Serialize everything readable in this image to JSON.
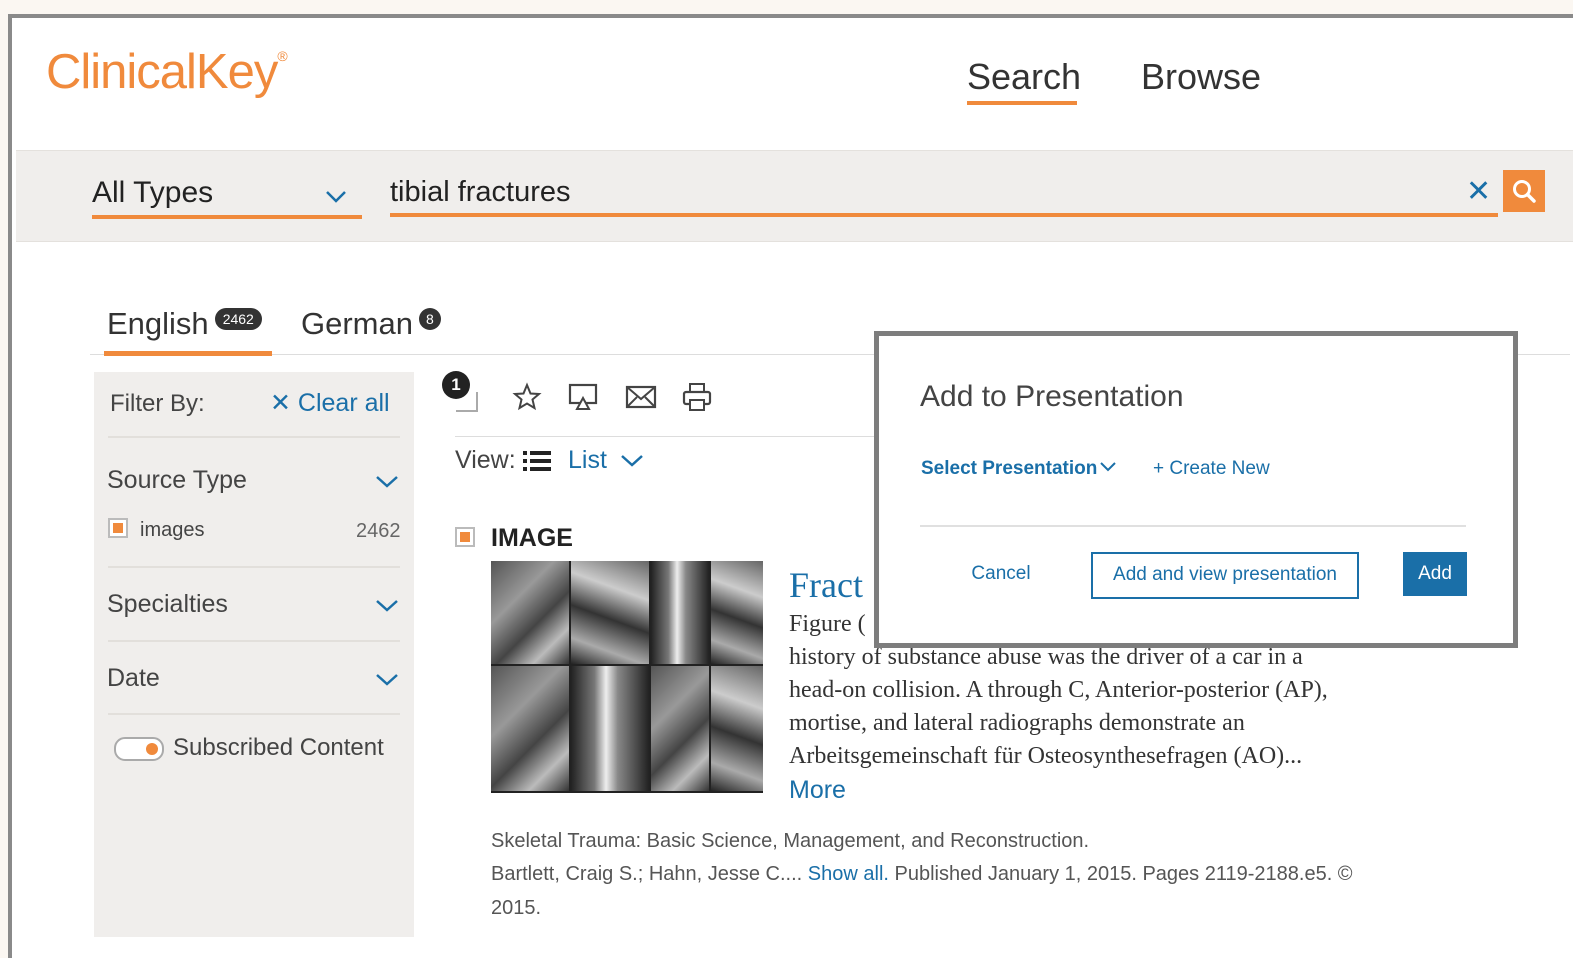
{
  "header": {
    "logo_text": "ClinicalKey",
    "logo_mark": "®",
    "nav": {
      "search": "Search",
      "browse": "Browse"
    }
  },
  "search": {
    "type_select": "All Types",
    "query": "tibial fractures",
    "clear_icon": "close-icon",
    "search_icon": "search-icon"
  },
  "languages": [
    {
      "label": "English",
      "count": "2462"
    },
    {
      "label": "German",
      "count": "8"
    }
  ],
  "sidebar": {
    "filter_by": "Filter By:",
    "clear_all": "Clear all",
    "source_type": "Source Type",
    "images_label": "images",
    "images_count": "2462",
    "specialties": "Specialties",
    "date": "Date",
    "subscribed": "Subscribed Content"
  },
  "toolbar": {
    "selected_count": "1",
    "icons": [
      "star-icon",
      "present-icon",
      "email-icon",
      "print-icon"
    ]
  },
  "view": {
    "label": "View:",
    "mode": "List"
  },
  "result": {
    "type_label": "IMAGE",
    "title": "Fract",
    "body_lines": [
      "Figure (",
      "history of substance abuse was the driver of a car in a",
      "head-on collision. A through C, Anterior-posterior (AP),",
      "mortise, and lateral radiographs demonstrate an",
      "Arbeitsgemeinschaft für Osteosynthesefragen (AO)..."
    ],
    "more": "More",
    "source": "Skeletal Trauma: Basic Science, Management, and Reconstruction.",
    "authors": "Bartlett, Craig S.; Hahn, Jesse C....",
    "show_all": "Show all.",
    "published": "Published January 1, 2015. Pages 2119-2188.e5. ©",
    "year": "2015."
  },
  "modal": {
    "title": "Add to Presentation",
    "select_presentation": "Select Presentation",
    "create_new": "+ Create New",
    "cancel": "Cancel",
    "add_and_view": "Add and view presentation",
    "add": "Add"
  },
  "colors": {
    "accent": "#f08a3c",
    "link": "#1a6fa8",
    "primary_button": "#1a6fa8"
  }
}
